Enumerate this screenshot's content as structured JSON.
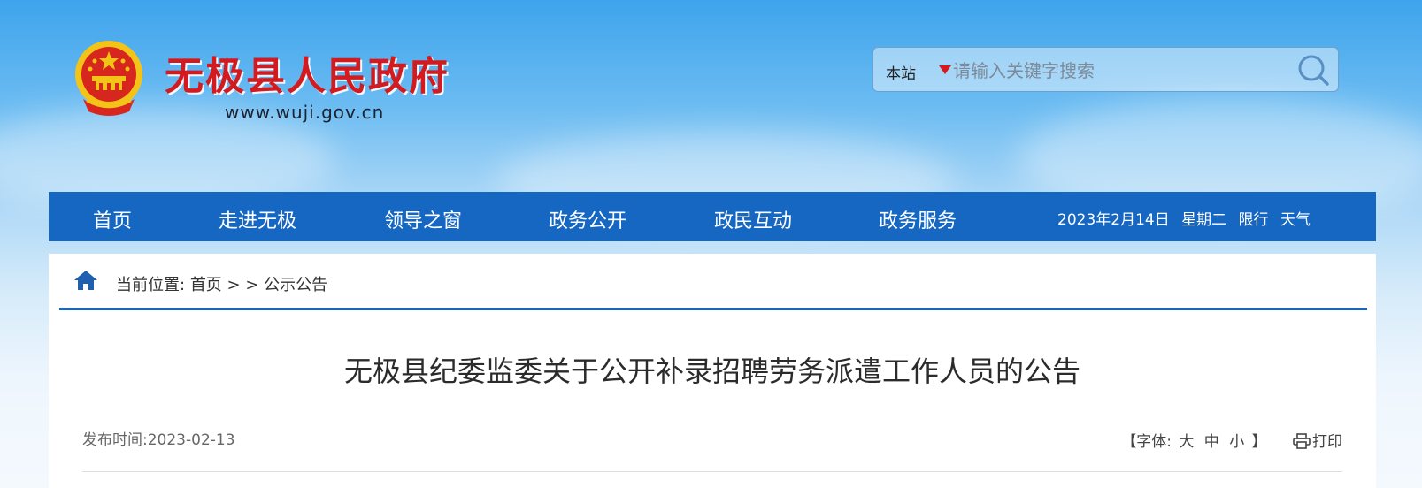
{
  "header": {
    "site_title": "无极县人民政府",
    "site_url": "www.wuji.gov.cn",
    "emblem_icon": "national-emblem-icon"
  },
  "search": {
    "scope": "本站",
    "placeholder": "请输入关键字搜索",
    "button_icon": "search-icon"
  },
  "nav": {
    "items": [
      "首页",
      "走进无极",
      "领导之窗",
      "政务公开",
      "政民互动",
      "政务服务"
    ],
    "date": "2023年2月14日",
    "weekday": "星期二",
    "traffic": "限行",
    "weather": "天气"
  },
  "breadcrumb": {
    "prefix": "当前位置:",
    "home": "首页",
    "separators": "> >",
    "current": "公示公告",
    "icon": "home-icon"
  },
  "article": {
    "title": "无极县纪委监委关于公开补录招聘劳务派遣工作人员的公告",
    "publish_label": "发布时间:",
    "publish_date": "2023-02-13",
    "font_label_open": "【字体:",
    "font_large": "大",
    "font_medium": "中",
    "font_small": "小",
    "font_label_close": "】",
    "print_label": "打印",
    "print_icon": "printer-icon"
  },
  "colors": {
    "nav_bg": "#1667c2",
    "title_red": "#d21a1f",
    "sky_top": "#3ea4ec"
  }
}
